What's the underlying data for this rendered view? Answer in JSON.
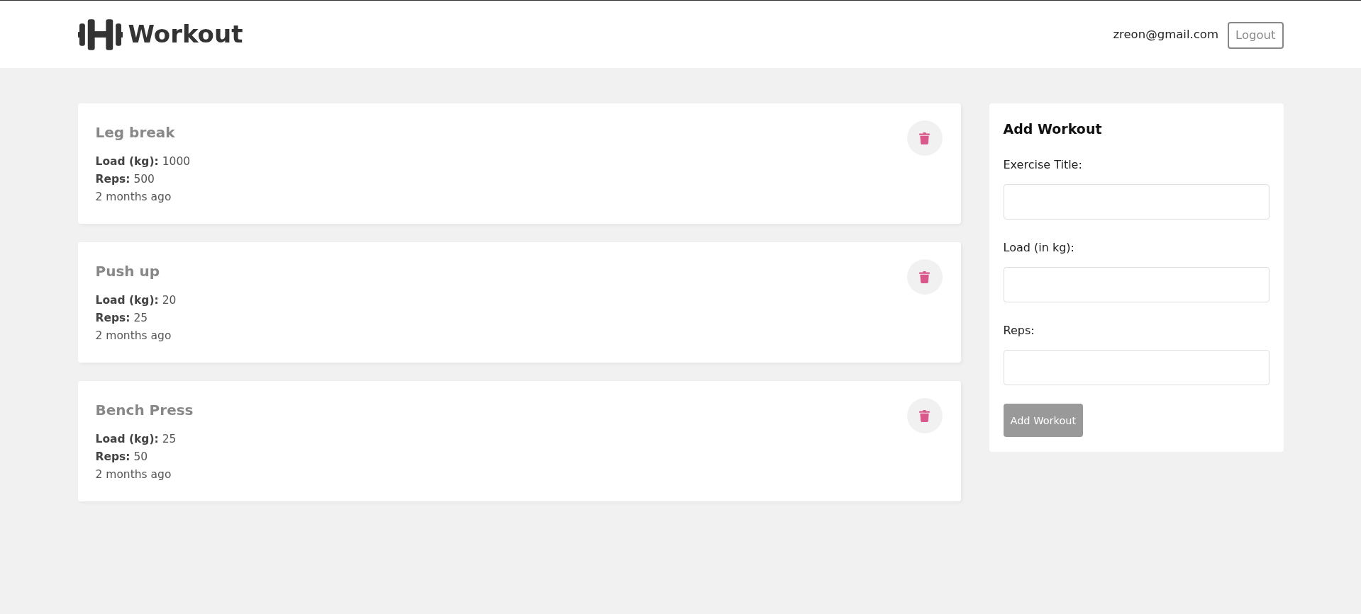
{
  "header": {
    "logo_text": "Workout",
    "user_email": "zreon@gmail.com",
    "logout_button": "Logout"
  },
  "workouts": [
    {
      "title": "Leg break",
      "load": "**Load (kg):** 1000",
      "reps": "**Reps:** 500",
      "time": "2 months ago"
    },
    {
      "title": "Push up",
      "load": "**Load (kg):** 20",
      "reps": "**Reps:** 25",
      "time": "2 months ago"
    },
    {
      "title": "Bench Press",
      "load": "**Load (kg):** 25",
      "reps": "**Reps:** 50",
      "time": "2 months ago"
    }
  ],
  "form": {
    "title": "Add Workout",
    "fields": [
      {
        "label": "Exercise Title:"
      },
      {
        "label": "Load (in kg):"
      },
      {
        "label": "Reps:"
      }
    ],
    "submit_button": "Add Workout"
  }
}
